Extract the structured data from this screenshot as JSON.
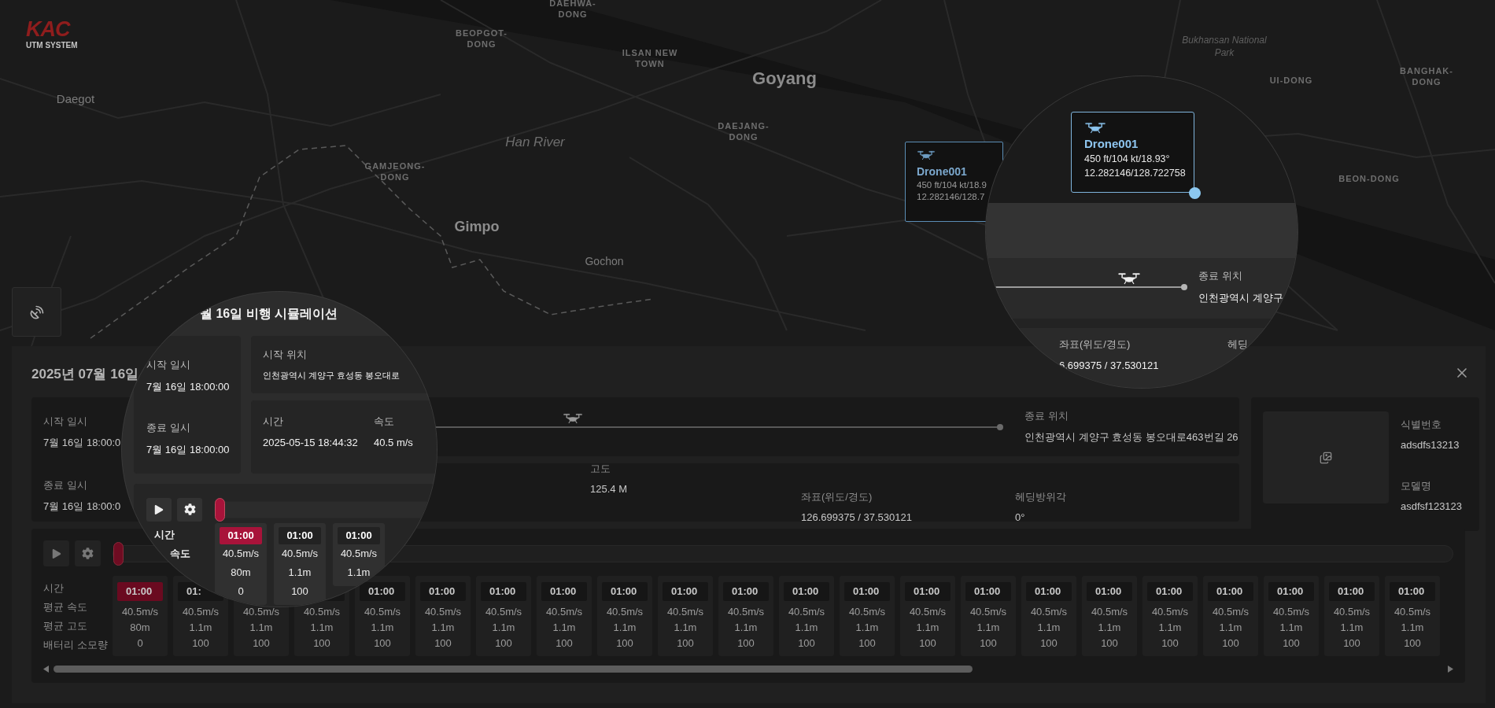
{
  "logo": {
    "mark": "KAC",
    "subtitle": "UTM SYSTEM"
  },
  "map_labels": [
    {
      "text": "DAEHWA-DONG",
      "kind": "district"
    },
    {
      "text": "BEOPGOT-DONG",
      "kind": "district"
    },
    {
      "text": "ILSAN NEW TOWN",
      "kind": "district"
    },
    {
      "text": "Goyang",
      "kind": "city"
    },
    {
      "text": "Bukhansan National Park",
      "kind": "park"
    },
    {
      "text": "UI-DONG",
      "kind": "district"
    },
    {
      "text": "BANGHAK-DONG",
      "kind": "district"
    },
    {
      "text": "Daegot",
      "kind": "town"
    },
    {
      "text": "DAEJANG-DONG",
      "kind": "district"
    },
    {
      "text": "Han River",
      "kind": "water"
    },
    {
      "text": "GAMJEONG-DONG",
      "kind": "district"
    },
    {
      "text": "BEON-DONG",
      "kind": "district"
    },
    {
      "text": "Gimpo",
      "kind": "city"
    },
    {
      "text": "Gochon",
      "kind": "town"
    }
  ],
  "drone_tag": {
    "name": "Drone001",
    "telemetry": "450 ft/104 kt/18.9",
    "coordinates": "12.282146/128.7"
  },
  "panel": {
    "title": "2025년 07월 16일",
    "start_time": {
      "label": "시작 일시",
      "value": "7월 16일 18:00:0"
    },
    "end_time": {
      "label": "종료 일시",
      "value": "7월 16일 18:00:0"
    },
    "route": {
      "level": 0.46,
      "end_label": "종료 위치",
      "end_address": "인천광역시 계양구 효성동 봉오대로463번길 26"
    },
    "stats": [
      {
        "label": "고도",
        "value": "125.4 M"
      },
      {
        "label": "좌표(위도/경도)",
        "value": "126.699375 / 37.530121"
      },
      {
        "label": "헤딩방위각",
        "value": "0°"
      }
    ],
    "device": {
      "id_label": "식별번호",
      "id": "adsdfs13213",
      "model_label": "모델명",
      "model": "asdfsf123123"
    },
    "timeline": {
      "level": 0,
      "row_labels": [
        "시간",
        "평균 속도",
        "평균 고도",
        "배터리 소모량"
      ],
      "cells": [
        {
          "time": "01:00",
          "speed": "40.5m/s",
          "altitude": "80m",
          "battery": "0",
          "selected": true
        },
        {
          "time": "01:",
          "speed": "40.5m/s",
          "altitude": "1.1m",
          "battery": "100",
          "selected": false
        },
        {
          "speed": "40.5m/s",
          "altitude": "1.1m",
          "battery": "100"
        },
        {
          "speed": "40.5m/s",
          "altitude": "1.1m",
          "battery": "100"
        },
        {
          "time": "01:00",
          "speed": "40.5m/s",
          "altitude": "1.1m",
          "battery": "100",
          "selected": false
        },
        {
          "time": "01:00",
          "speed": "40.5m/s",
          "altitude": "1.1m",
          "battery": "100",
          "selected": false
        },
        {
          "time": "01:00",
          "speed": "40.5m/s",
          "altitude": "1.1m",
          "battery": "100",
          "selected": false
        },
        {
          "time": "01:00",
          "speed": "40.5m/s",
          "altitude": "1.1m",
          "battery": "100",
          "selected": false
        },
        {
          "time": "01:00",
          "speed": "40.5m/s",
          "altitude": "1.1m",
          "battery": "100",
          "selected": false
        },
        {
          "time": "01:00",
          "speed": "40.5m/s",
          "altitude": "1.1m",
          "battery": "100",
          "selected": false
        },
        {
          "time": "01:00",
          "speed": "40.5m/s",
          "altitude": "1.1m",
          "battery": "100",
          "selected": false
        },
        {
          "time": "01:00",
          "speed": "40.5m/s",
          "altitude": "1.1m",
          "battery": "100",
          "selected": false
        },
        {
          "time": "01:00",
          "speed": "40.5m/s",
          "altitude": "1.1m",
          "battery": "100",
          "selected": false
        },
        {
          "time": "01:00",
          "speed": "40.5m/s",
          "altitude": "1.1m",
          "battery": "100",
          "selected": false
        },
        {
          "time": "01:00",
          "speed": "40.5m/s",
          "altitude": "1.1m",
          "battery": "100",
          "selected": false
        },
        {
          "time": "01:00",
          "speed": "40.5m/s",
          "altitude": "1.1m",
          "battery": "100",
          "selected": false
        },
        {
          "time": "01:00",
          "speed": "40.5m/s",
          "altitude": "1.1m",
          "battery": "100",
          "selected": false
        },
        {
          "time": "01:00",
          "speed": "40.5m/s",
          "altitude": "1.1m",
          "battery": "100",
          "selected": false
        },
        {
          "time": "01:00",
          "speed": "40.5m/s",
          "altitude": "1.1m",
          "battery": "100",
          "selected": false
        },
        {
          "time": "01:00",
          "speed": "40.5m/s",
          "altitude": "1.1m",
          "battery": "100",
          "selected": false
        },
        {
          "time": "01:00",
          "speed": "40.5m/s",
          "altitude": "1.1m",
          "battery": "100",
          "selected": false
        },
        {
          "time": "01:00",
          "speed": "40.5m/s",
          "altitude": "1.1m",
          "battery": "100",
          "selected": false
        }
      ]
    }
  },
  "magnifier_left": {
    "title": "월 16일 비행 시뮬레이션",
    "start_time": {
      "label": "시작 일시",
      "value": "7월 16일 18:00:00"
    },
    "end_time": {
      "label": "종료 일시",
      "value": "7월 16일 18:00:00"
    },
    "start_location": {
      "label": "시작 위치",
      "value": "인천광역시 계양구 효성동 봉오대로"
    },
    "readings": [
      {
        "label": "시간",
        "value": "2025-05-15 18:44:32"
      },
      {
        "label": "속도",
        "value": "40.5 m/s"
      }
    ],
    "timeline": {
      "level": 0,
      "row_labels": [
        "시간",
        "속도"
      ],
      "cells": [
        {
          "time": "01:00",
          "speed": "40.5m/s",
          "altitude": "80m",
          "battery": "0",
          "selected": true
        },
        {
          "time": "01:00",
          "speed": "40.5m/s",
          "altitude": "1.1m",
          "battery": "100",
          "selected": false
        },
        {
          "time": "01:00",
          "speed": "40.5m/s",
          "altitude": "1.1m",
          "selected": false
        }
      ]
    }
  },
  "magnifier_right": {
    "drone_tag": {
      "name": "Drone001",
      "telemetry": "450 ft/104 kt/18.93°",
      "coordinates": "12.282146/128.722758"
    },
    "route": {
      "level": 0.71,
      "end_label": "종료 위치",
      "end_address": "인천광역시 계양구"
    },
    "stats": [
      {
        "label": "좌표(위도/경도)",
        "value": "6.699375 / 37.530121"
      },
      {
        "label": "헤딩"
      }
    ]
  }
}
